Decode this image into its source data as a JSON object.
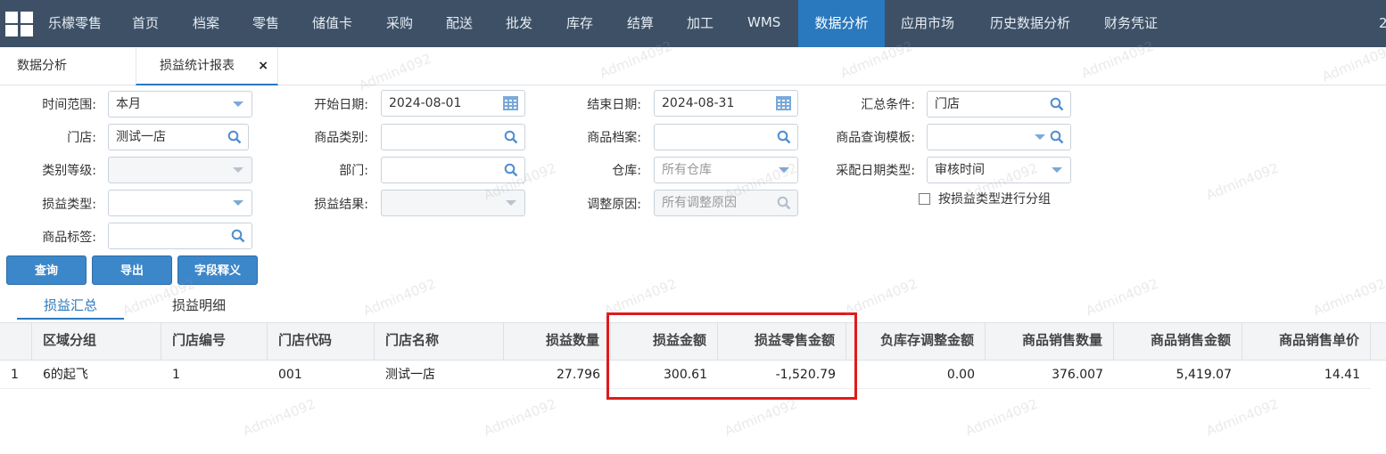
{
  "topnav": {
    "brand": "乐檬零售",
    "items": [
      "首页",
      "档案",
      "零售",
      "储值卡",
      "采购",
      "配送",
      "批发",
      "库存",
      "结算",
      "加工",
      "WMS",
      "数据分析",
      "应用市场",
      "历史数据分析",
      "财务凭证"
    ],
    "active": "数据分析",
    "overflow_text": "2"
  },
  "tabs": {
    "home_label": "数据分析",
    "report_label": "损益统计报表",
    "close_glyph": "×"
  },
  "filters": {
    "time_range_label": "时间范围:",
    "time_range_value": "本月",
    "start_date_label": "开始日期:",
    "start_date_value": "2024-08-01",
    "end_date_label": "结束日期:",
    "end_date_value": "2024-08-31",
    "summary_label": "汇总条件:",
    "summary_value": "门店",
    "store_label": "门店:",
    "store_value": "测试一店",
    "category_label": "商品类别:",
    "item_label": "商品档案:",
    "query_template_label": "商品查询模板:",
    "category_level_label": "类别等级:",
    "dept_label": "部门:",
    "warehouse_label": "仓库:",
    "warehouse_value": "所有仓库",
    "purchase_date_type_label": "采配日期类型:",
    "purchase_date_type_value": "审核时间",
    "pl_type_label": "损益类型:",
    "pl_result_label": "损益结果:",
    "adjust_reason_label": "调整原因:",
    "adjust_reason_placeholder": "所有调整原因",
    "group_checkbox_label": "按损益类型进行分组",
    "tag_label": "商品标签:"
  },
  "buttons": {
    "query": "查询",
    "export": "导出",
    "field_def": "字段释义"
  },
  "subtabs": {
    "summary": "损益汇总",
    "detail": "损益明细"
  },
  "table": {
    "headers": [
      "区域分组",
      "门店编号",
      "门店代码",
      "门店名称",
      "损益数量",
      "损益金额",
      "损益零售金额",
      "负库存调整金额",
      "商品销售数量",
      "商品销售金额",
      "商品销售单价"
    ],
    "rows": [
      {
        "index": "1",
        "cells": [
          "6的起飞",
          "1",
          "001",
          "测试一店",
          "27.796",
          "300.61",
          "-1,520.79",
          "0.00",
          "376.007",
          "5,419.07",
          "14.41"
        ]
      }
    ]
  },
  "watermark": "Admin4092",
  "colors": {
    "nav_bg": "#3d5066",
    "nav_active": "#2a78bd",
    "button": "#3c87c9",
    "highlight": "#e01a1a"
  }
}
